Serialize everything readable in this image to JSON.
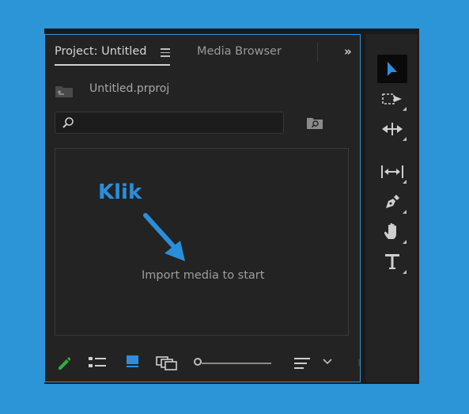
{
  "project_panel": {
    "tabs": [
      {
        "label": "Project: Untitled",
        "active": true
      },
      {
        "label": "Media Browser",
        "active": false
      }
    ],
    "overflow_label": "»",
    "file_name": "Untitled.prproj",
    "search": {
      "value": "",
      "placeholder": ""
    },
    "annotation_label": "Klik",
    "empty_message": "Import media to start",
    "accent_color": "#2a8fdb"
  },
  "bottom_toolbar": {
    "icons": [
      "pencil-icon",
      "list-view-icon",
      "icon-view-icon",
      "freeform-view-icon",
      "zoom-slider",
      "sort-icon",
      "chevron-down-icon"
    ],
    "selected_view": "icon-view"
  },
  "tools": {
    "items": [
      {
        "name": "selection-tool",
        "selected": true
      },
      {
        "name": "track-select-tool",
        "selected": false
      },
      {
        "name": "ripple-edit-tool",
        "selected": false
      },
      {
        "name": "slip-tool",
        "selected": false
      },
      {
        "name": "pen-tool",
        "selected": false
      },
      {
        "name": "hand-tool",
        "selected": false
      },
      {
        "name": "type-tool",
        "selected": false
      }
    ]
  }
}
